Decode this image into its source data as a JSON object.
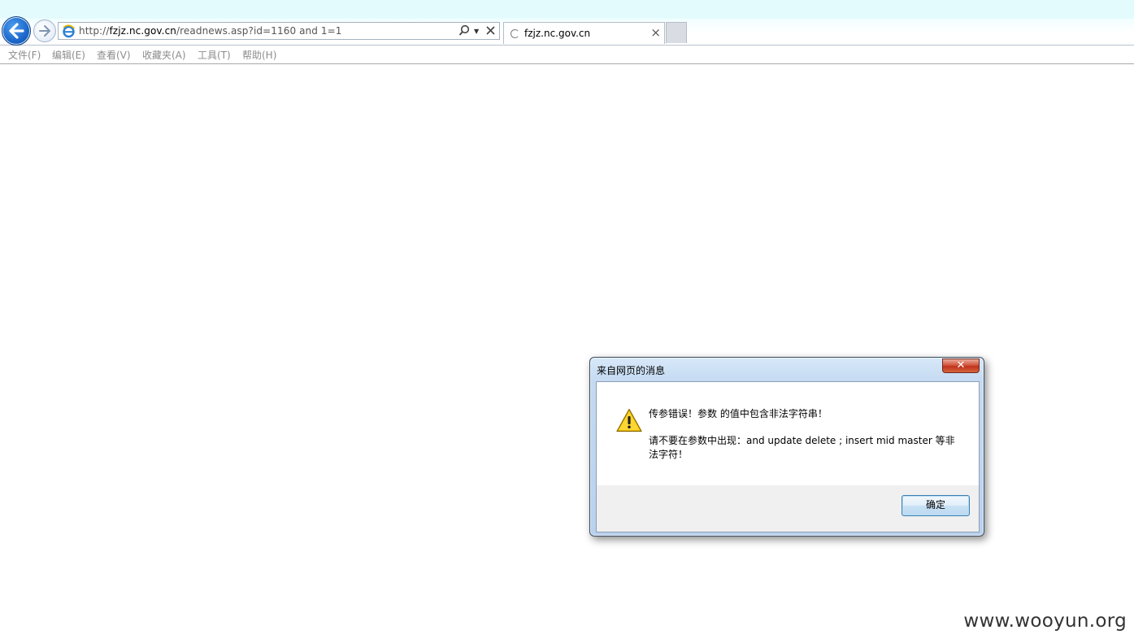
{
  "browser": {
    "address_bar": {
      "url_prefix": "http://",
      "url_host": "fzjz.nc.gov.cn",
      "url_path": "/readnews.asp?id=1160 and 1=1"
    },
    "tab": {
      "title": "fzjz.nc.gov.cn",
      "close_label": "×"
    },
    "menu": [
      {
        "label": "文件(F)"
      },
      {
        "label": "编辑(E)"
      },
      {
        "label": "查看(V)"
      },
      {
        "label": "收藏夹(A)"
      },
      {
        "label": "工具(T)"
      },
      {
        "label": "帮助(H)"
      }
    ]
  },
  "dialog": {
    "title": "来自网页的消息",
    "close_label": "✕",
    "message_line1": "传参错误！参数  的值中包含非法字符串！",
    "message_line2": "请不要在参数中出现：and update delete ; insert mid master 等非法字符！",
    "ok_label": "确定"
  },
  "watermark": "www.wooyun.org",
  "colors": {
    "back_button": "#1b66c9",
    "dialog_frame": "#b8d1ee",
    "close_button": "#c0321c",
    "warning_triangle": "#f5c400"
  }
}
